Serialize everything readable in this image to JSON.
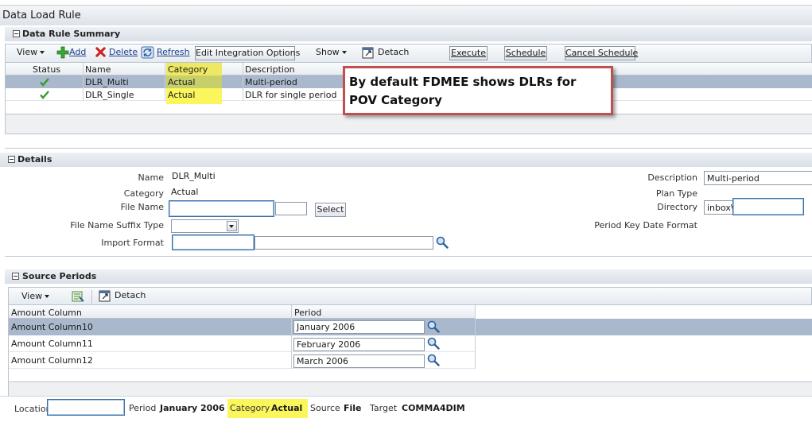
{
  "page": {
    "title": "Data Load Rule"
  },
  "summary": {
    "header": "Data Rule Summary",
    "toolbar": {
      "view": "View",
      "add": "Add",
      "delete": "Delete",
      "refresh": "Refresh",
      "edit_integration": "Edit Integration Options",
      "show": "Show",
      "detach": "Detach",
      "execute": "Execute",
      "schedule": "Schedule",
      "cancel_schedule": "Cancel Schedule"
    },
    "columns": {
      "status": "Status",
      "name": "Name",
      "category": "Category",
      "description": "Description"
    },
    "rows": [
      {
        "name": "DLR_Multi",
        "category": "Actual",
        "description": "Multi-period"
      },
      {
        "name": "DLR_Single",
        "category": "Actual",
        "description": "DLR for single period"
      }
    ]
  },
  "callout": {
    "text": "By default FDMEE shows DLRs for POV Category"
  },
  "details": {
    "header": "Details",
    "name_label": "Name",
    "name_value": "DLR_Multi",
    "category_label": "Category",
    "category_value": "Actual",
    "file_name_label": "File Name",
    "select_button": "Select",
    "suffix_label": "File Name Suffix Type",
    "import_format_label": "Import Format",
    "description_label": "Description",
    "description_value": "Multi-period",
    "plan_type_label": "Plan Type",
    "directory_label": "Directory",
    "directory_value": "inbox\\",
    "period_key_label": "Period Key Date Format"
  },
  "source_periods": {
    "header": "Source Periods",
    "toolbar": {
      "view": "View",
      "detach": "Detach"
    },
    "columns": {
      "amount": "Amount Column",
      "period": "Period"
    },
    "rows": [
      {
        "amount": "Amount Column10",
        "period": "January 2006"
      },
      {
        "amount": "Amount Column11",
        "period": "February 2006"
      },
      {
        "amount": "Amount Column12",
        "period": "March 2006"
      }
    ]
  },
  "pov": {
    "location_label": "Location",
    "period_label": "Period",
    "period_value": "January 2006",
    "category_label": "Category",
    "category_value": "Actual",
    "source_label": "Source",
    "source_value": "File",
    "target_label": "Target",
    "target_value": "COMMA4DIM"
  },
  "colors": {
    "highlight": "#fbf65c",
    "callout_border": "#c0504d",
    "selected_row": "#a9b8cc",
    "check": "#3a9a2a"
  }
}
